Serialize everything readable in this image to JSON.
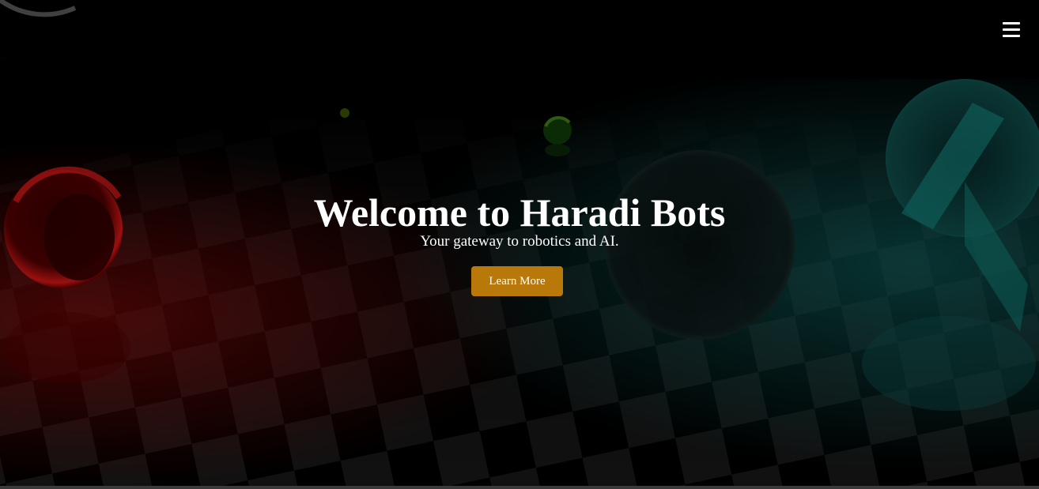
{
  "hero": {
    "title": "Welcome to Haradi Bots",
    "subtitle": "Your gateway to robotics and AI.",
    "cta_label": "Learn More"
  },
  "nav": {
    "menu_icon": "hamburger-menu-icon"
  },
  "colors": {
    "background": "#000000",
    "accent": "#b8790a",
    "text": "#ffffff",
    "sphere_red": "#8a0f0a",
    "sphere_teal": "#0f5a58"
  }
}
